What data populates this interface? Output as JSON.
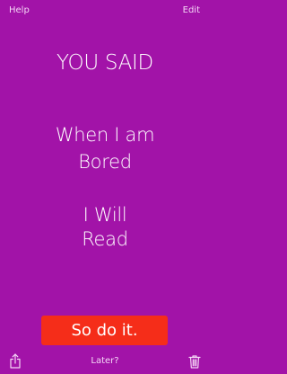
{
  "nav": {
    "left_label": "Help",
    "right_label": "Edit"
  },
  "heading": "YOU SAID",
  "statement": {
    "line1": "When I am",
    "line2": "Bored",
    "line3": "I Will",
    "line4": "Read"
  },
  "cta_label": "So do it.",
  "later_label": "Later?",
  "icons": {
    "share": "share-icon",
    "trash": "trash-icon"
  },
  "colors": {
    "background": "#a213a8",
    "button": "#f52d19",
    "text": "#ffffff"
  }
}
